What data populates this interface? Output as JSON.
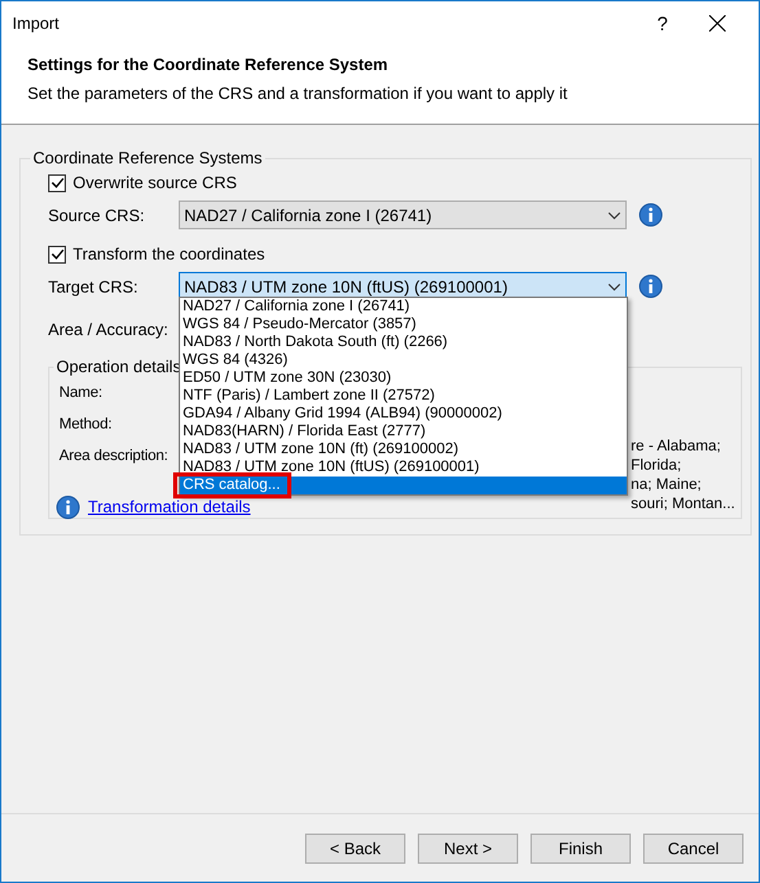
{
  "window": {
    "title": "Import",
    "help": "?"
  },
  "header": {
    "title": "Settings for the Coordinate Reference System",
    "subtitle": "Set the parameters of the CRS and a transformation if you want to apply it"
  },
  "crs_group": {
    "title": "Coordinate Reference Systems",
    "overwrite": {
      "label": "Overwrite source CRS",
      "checked": true
    },
    "source": {
      "label": "Source CRS:",
      "value": "NAD27 / California zone I (26741)"
    },
    "transform": {
      "label": "Transform the coordinates",
      "checked": true
    },
    "target": {
      "label": "Target CRS:",
      "value": "NAD83 / UTM zone 10N (ftUS) (269100001)",
      "expanded": true
    },
    "area_accuracy": {
      "label": "Area / Accuracy:"
    },
    "operation": {
      "title": "Operation details",
      "name_label": "Name:",
      "method_label": "Method:",
      "area_label": "Area description:",
      "area_fragments": [
        "re - Alabama;",
        "Florida;",
        "na; Maine;",
        "souri; Montan..."
      ]
    },
    "link": "Transformation details"
  },
  "dropdown": {
    "options": [
      {
        "label": "NAD27 / California zone I (26741)",
        "selected": false,
        "highlighted": false
      },
      {
        "label": "WGS 84 / Pseudo-Mercator (3857)",
        "selected": false,
        "highlighted": false
      },
      {
        "label": "NAD83 / North Dakota South (ft) (2266)",
        "selected": false,
        "highlighted": false
      },
      {
        "label": "WGS 84 (4326)",
        "selected": false,
        "highlighted": false
      },
      {
        "label": "ED50 / UTM zone 30N (23030)",
        "selected": false,
        "highlighted": false
      },
      {
        "label": "NTF (Paris) / Lambert zone II (27572)",
        "selected": false,
        "highlighted": false
      },
      {
        "label": "GDA94 / Albany Grid 1994 (ALB94)  (90000002)",
        "selected": false,
        "highlighted": false
      },
      {
        "label": "NAD83(HARN) / Florida East (2777)",
        "selected": false,
        "highlighted": false
      },
      {
        "label": "NAD83 / UTM zone 10N (ft) (269100002)",
        "selected": false,
        "highlighted": false
      },
      {
        "label": "NAD83 / UTM zone 10N (ftUS) (269100001)",
        "selected": false,
        "highlighted": false
      },
      {
        "label": "CRS catalog...",
        "selected": true,
        "highlighted": true
      }
    ]
  },
  "buttons": [
    {
      "label": "< Back"
    },
    {
      "label": "Next >"
    },
    {
      "label": "Finish"
    },
    {
      "label": "Cancel"
    }
  ]
}
